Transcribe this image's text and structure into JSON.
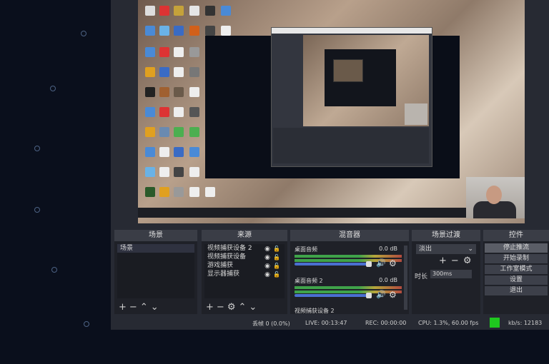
{
  "scenes": {
    "title": "场景",
    "items": [
      "场景"
    ]
  },
  "sources": {
    "title": "来源",
    "items": [
      "视频捕获设备 2",
      "视频捕获设备",
      "游戏捕获",
      "显示器捕获"
    ]
  },
  "mixer": {
    "title": "混音器",
    "tracks": [
      {
        "name": "桌面音频",
        "level": "0.0 dB"
      },
      {
        "name": "桌面音频 2",
        "level": "0.0 dB"
      },
      {
        "name": "视频捕获设备 2",
        "level": ""
      }
    ]
  },
  "transitions": {
    "title": "场景过渡",
    "selected": "淡出",
    "duration_label": "时长",
    "duration_value": "300ms"
  },
  "controls": {
    "title": "控件",
    "buttons": [
      "停止推流",
      "开始录制",
      "工作室模式",
      "设置",
      "退出"
    ]
  },
  "status": {
    "dropped": "丢帧 0 (0.0%)",
    "live": "LIVE: 00:13:47",
    "rec": "REC: 00:00:00",
    "cpu": "CPU: 1.3%, 60.00 fps",
    "kbps": "kb/s: 12183"
  },
  "icons": {
    "add": "plus-icon",
    "remove": "minus-icon",
    "settings": "gear-icon",
    "up": "chevron-up-icon",
    "down": "chevron-down-icon",
    "eye": "eye-icon",
    "lock": "lock-icon",
    "speaker": "speaker-icon"
  },
  "colors": {
    "accent_green": "#1fc81f",
    "volume_blue": "#4a6fd1",
    "panel_bg": "#1f2128",
    "app_bg": "#272a33"
  }
}
